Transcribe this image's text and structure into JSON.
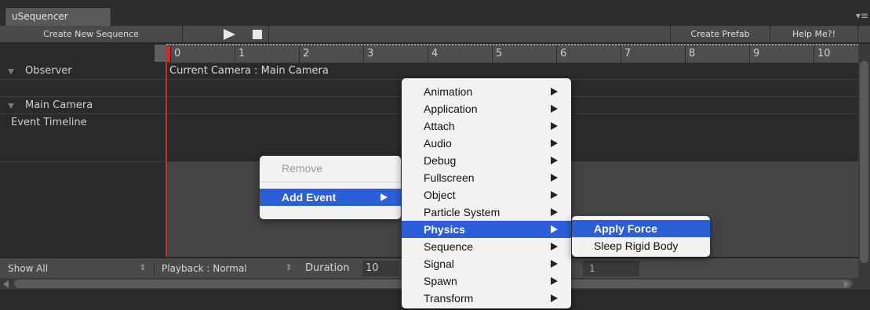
{
  "window": {
    "tab_title": "uSequencer",
    "tab_menu_icon": "list-menu-icon"
  },
  "toolbar": {
    "create_sequence_label": "Create New Sequence",
    "create_prefab_label": "Create Prefab",
    "help_label": "Help Me?!"
  },
  "ruler": {
    "labels": [
      "0",
      "1",
      "2",
      "3",
      "4",
      "5",
      "6",
      "7",
      "8",
      "9",
      "10"
    ]
  },
  "tracks": {
    "observer_label": "Observer",
    "observer_value": "Current Camera : Main Camera",
    "main_camera_label": "Main Camera",
    "event_timeline_label": "Event Timeline"
  },
  "statusbar": {
    "show_all": "Show All",
    "playback": "Playback : Normal",
    "duration_label": "Duration",
    "duration_value": "10",
    "field_value": "1"
  },
  "context_menu": {
    "items": [
      {
        "label": "Remove",
        "disabled": true
      },
      {
        "label": "Add Event",
        "selected": true,
        "has_submenu": true
      }
    ]
  },
  "event_menu": {
    "items": [
      "Animation",
      "Application",
      "Attach",
      "Audio",
      "Debug",
      "Fullscreen",
      "Object",
      "Particle System",
      "Physics",
      "Sequence",
      "Signal",
      "Spawn",
      "Transform"
    ],
    "selected": "Physics"
  },
  "physics_menu": {
    "items": [
      "Apply Force",
      "Sleep Rigid Body"
    ],
    "selected": "Apply Force"
  },
  "colors": {
    "playhead": "#c8302f",
    "menu_highlight": "#2a5fd8",
    "menu_background": "#f2f2f2"
  }
}
